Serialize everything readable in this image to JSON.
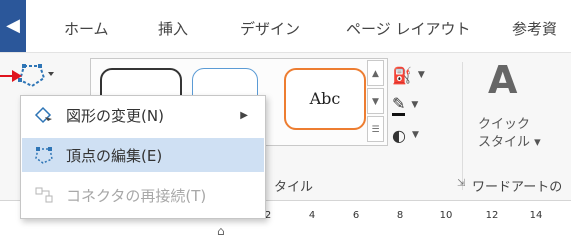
{
  "tabs": [
    {
      "label": "ホーム"
    },
    {
      "label": "挿入"
    },
    {
      "label": "デザイン"
    },
    {
      "label": "ページ レイアウト"
    },
    {
      "label": "参考資"
    }
  ],
  "shape_gallery": {
    "sample_text": "Abc",
    "group_label": "タイル"
  },
  "wordart": {
    "quick_style_label_line1": "クイック",
    "quick_style_label_line2": "スタイル ▾",
    "group_label": "ワードアートの"
  },
  "menu": {
    "items": [
      {
        "label": "図形の変更(N)",
        "submenu": true,
        "enabled": true
      },
      {
        "label": "頂点の編集(E)",
        "submenu": false,
        "enabled": true,
        "highlighted": true
      },
      {
        "label": "コネクタの再接続(T)",
        "submenu": false,
        "enabled": false
      }
    ]
  },
  "ruler": {
    "ticks": [
      "8",
      "6",
      "4",
      "2",
      "2",
      "4",
      "6",
      "8",
      "10",
      "12",
      "14"
    ]
  },
  "colors": {
    "accent": "#2b579a",
    "menu_highlight": "#cfe0f3",
    "annotation": "#e0141e",
    "shape_style_3_border": "#ed7d31",
    "shape_style_2_border": "#5b9bd5"
  }
}
